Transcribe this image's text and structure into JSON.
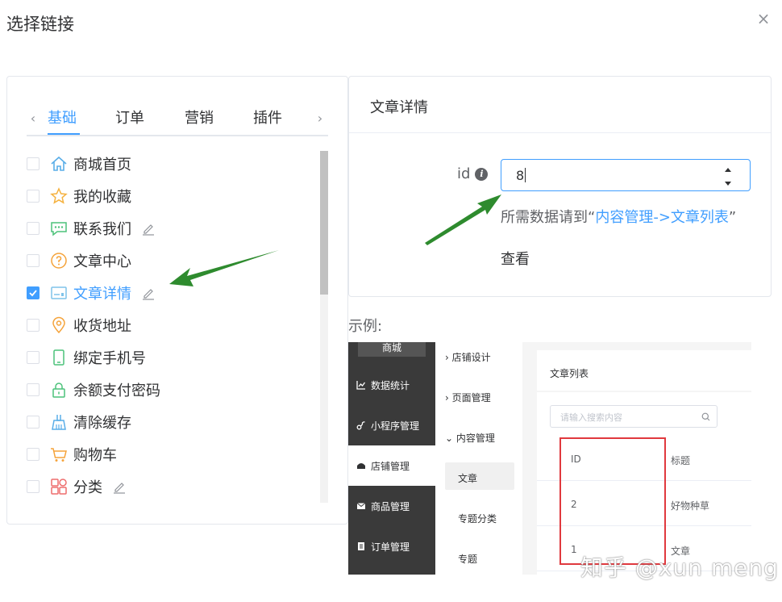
{
  "dialog": {
    "title": "选择链接",
    "close_icon": "×"
  },
  "tabs": {
    "prev_icon": "‹",
    "next_icon": "›",
    "items": [
      {
        "label": "基础",
        "active": true
      },
      {
        "label": "订单",
        "active": false
      },
      {
        "label": "营销",
        "active": false
      },
      {
        "label": "插件",
        "active": false
      }
    ]
  },
  "links": [
    {
      "label": "商城首页",
      "icon": "home-icon",
      "checked": false,
      "editable": false
    },
    {
      "label": "我的收藏",
      "icon": "star-icon",
      "checked": false,
      "editable": false
    },
    {
      "label": "联系我们",
      "icon": "chat-icon",
      "checked": false,
      "editable": true
    },
    {
      "label": "文章中心",
      "icon": "question-icon",
      "checked": false,
      "editable": false
    },
    {
      "label": "文章详情",
      "icon": "article-icon",
      "checked": true,
      "editable": true
    },
    {
      "label": "收货地址",
      "icon": "location-icon",
      "checked": false,
      "editable": false
    },
    {
      "label": "绑定手机号",
      "icon": "phone-icon",
      "checked": false,
      "editable": false
    },
    {
      "label": "余额支付密码",
      "icon": "lock-icon",
      "checked": false,
      "editable": false
    },
    {
      "label": "清除缓存",
      "icon": "broom-icon",
      "checked": false,
      "editable": false
    },
    {
      "label": "购物车",
      "icon": "cart-icon",
      "checked": false,
      "editable": false
    },
    {
      "label": "分类",
      "icon": "category-icon",
      "checked": false,
      "editable": true
    }
  ],
  "detail": {
    "title": "文章详情",
    "id_label": "id",
    "id_value": "8",
    "hint_prefix": "所需数据请到",
    "hint_quote_open": "“",
    "hint_link": "内容管理->文章列表",
    "hint_quote_close": "”",
    "view_label": "查看"
  },
  "example": {
    "label": "示例:",
    "logo": "商城",
    "side": [
      "数据统计",
      "小程序管理",
      "店铺管理",
      "商品管理",
      "订单管理"
    ],
    "sub": [
      "店铺设计",
      "页面管理",
      "内容管理",
      "文章",
      "专题分类",
      "专题"
    ],
    "page_title": "文章列表",
    "search_placeholder": "请输入搜索内容",
    "table_headers": [
      "ID",
      "标题"
    ],
    "rows": [
      {
        "id": "2",
        "title": "好物种草"
      },
      {
        "id": "1",
        "title": "文章"
      }
    ]
  },
  "watermark": "知乎 @xun meng",
  "colors": {
    "accent": "#409eff",
    "arrow": "#2e8b2e",
    "highlight": "#e0393e"
  }
}
